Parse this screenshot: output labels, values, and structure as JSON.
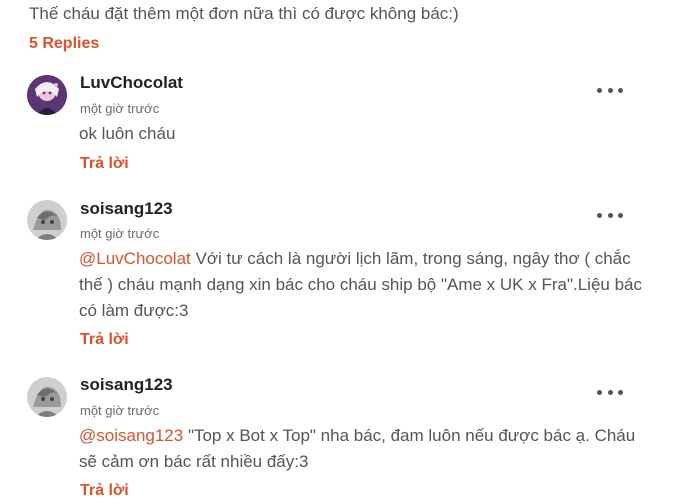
{
  "parent": {
    "text": "Thế cháu đặt thêm một đơn nữa thì có được không bác:)",
    "replies_label": "5 Replies"
  },
  "comments": [
    {
      "username": "LuvChocolat",
      "timestamp": "một giờ trước",
      "mention": "",
      "text": "ok luôn cháu",
      "reply_label": "Trả lời",
      "more_icon": "more-horizontal-icon"
    },
    {
      "username": "soisang123",
      "timestamp": "một giờ trước",
      "mention": "@LuvChocolat",
      "text": " Với tư cách là người lịch lãm, trong sáng, ngây thơ ( chắc thế ) cháu mạnh dạng xin bác cho cháu ship bộ \"Ame x UK x Fra\".Liệu bác có làm được:3",
      "reply_label": "Trả lời",
      "more_icon": "more-horizontal-icon"
    },
    {
      "username": "soisang123",
      "timestamp": "một giờ trước",
      "mention": "@soisang123",
      "text": " \"Top x Bot x Top\" nha bác, đam luôn nếu được bác ạ. Cháu sẽ cảm ơn bác rất nhiều đấy:3",
      "reply_label": "Trả lời",
      "more_icon": "more-horizontal-icon"
    }
  ],
  "colors": {
    "accent": "#e0512b",
    "text": "#555555",
    "username": "#222222"
  }
}
